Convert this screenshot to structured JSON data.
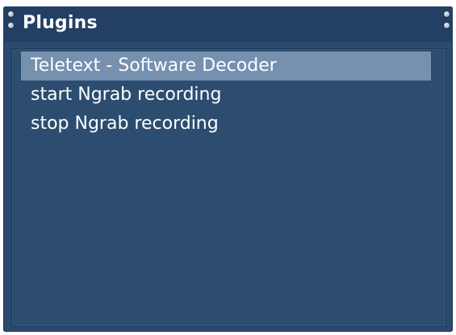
{
  "window": {
    "title": "Plugins"
  },
  "plugins": {
    "items": [
      {
        "label": "Teletext - Software Decoder",
        "selected": true
      },
      {
        "label": "start Ngrab recording",
        "selected": false
      },
      {
        "label": "stop Ngrab recording",
        "selected": false
      }
    ]
  },
  "colors": {
    "background": "#2a4a6e",
    "titlebar": "#233f63",
    "selection": "#7690b0",
    "text": "#ffffff"
  },
  "icons": {
    "decorative_screws": "screw-icon"
  }
}
